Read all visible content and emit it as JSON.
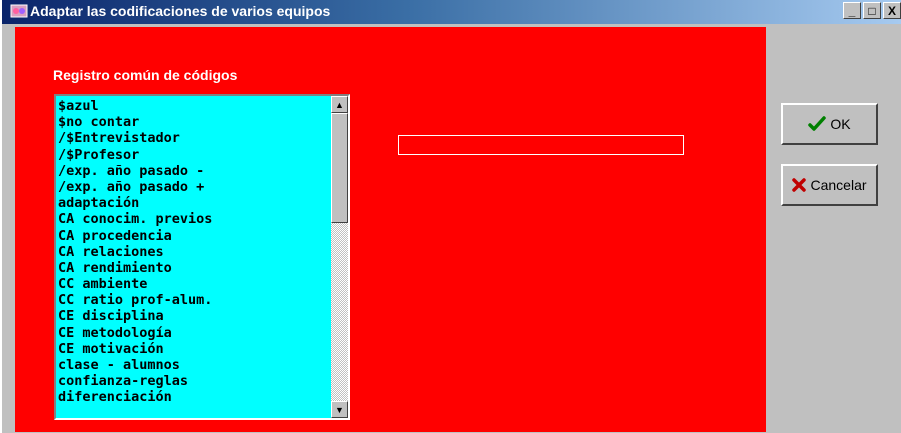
{
  "window": {
    "title": "Adaptar las codificaciones de varios equipos",
    "controls": {
      "minimize": "_",
      "maximize": "□",
      "close": "X"
    }
  },
  "list": {
    "label": "Registro común de códigos",
    "items": [
      "$azul",
      "$no contar",
      "/$Entrevistador",
      "/$Profesor",
      "/exp. año pasado -",
      "/exp. año pasado +",
      "adaptación",
      "CA conocim. previos",
      "CA procedencia",
      "CA relaciones",
      "CA rendimiento",
      "CC ambiente",
      "CC ratio prof-alum.",
      "CE disciplina",
      "CE metodología",
      "CE motivación",
      "clase - alumnos",
      "confianza-reglas",
      "diferenciación"
    ]
  },
  "text_field": {
    "value": ""
  },
  "buttons": {
    "ok": "OK",
    "cancel": "Cancelar"
  },
  "colors": {
    "panel": "#ff0000",
    "list_background": "#00ffff",
    "ok_icon": "#008000",
    "cancel_icon": "#c00000"
  },
  "icons": {
    "app": "app-icon",
    "ok": "checkmark-icon",
    "cancel": "x-mark-icon"
  }
}
